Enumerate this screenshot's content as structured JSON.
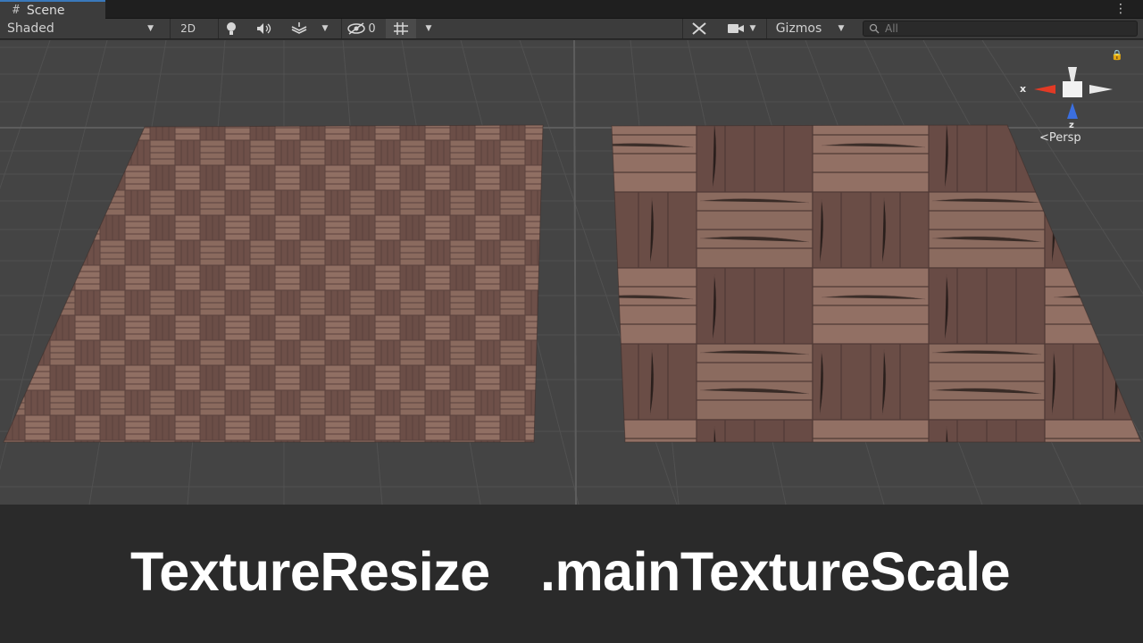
{
  "window": {
    "tab_label": "Scene",
    "tab_icon": "scene-hash-icon",
    "menu_icon": "kebab-menu-icon"
  },
  "toolbar": {
    "draw_mode": "Shaded",
    "mode_2d": "2D",
    "hidden_count": "0",
    "gizmos_label": "Gizmos",
    "search_placeholder": "All"
  },
  "viewport": {
    "orientation_axes": {
      "x": "x",
      "z": "z"
    },
    "projection_label": "Persp",
    "planes": [
      {
        "name": "TextureResize plane",
        "tiling": "fine"
      },
      {
        "name": "mainTextureScale plane",
        "tiling": "coarse"
      }
    ],
    "colors": {
      "background": "#444444",
      "wood_light": "#8d6a5f",
      "wood_dark": "#5e4540",
      "axis_x": "#e23a25",
      "axis_z": "#3b6fe0"
    }
  },
  "caption": {
    "left": "TextureResize",
    "right": ".mainTextureScale"
  }
}
